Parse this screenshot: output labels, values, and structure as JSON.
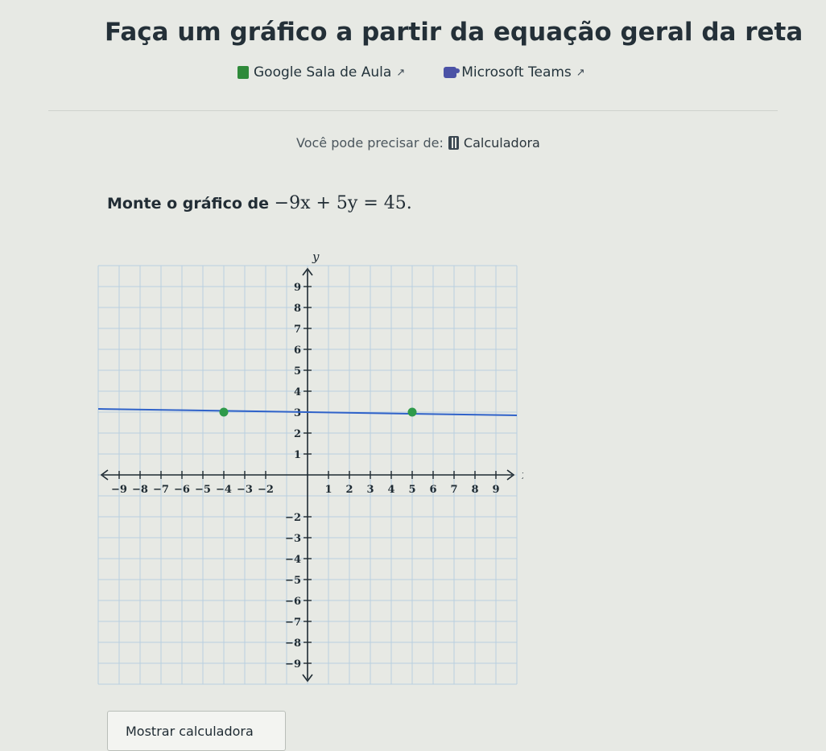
{
  "page": {
    "title": "Faça um gráfico a partir da equação geral da reta",
    "links": [
      {
        "label": "Google Sala de Aula",
        "icon": "google-classroom-icon"
      },
      {
        "label": "Microsoft Teams",
        "icon": "microsoft-teams-icon"
      }
    ],
    "resources": {
      "prefix": "Você pode precisar de:",
      "calculator_label": "Calculadora"
    },
    "question": {
      "prefix": "Monte o gráfico de",
      "equation": "−9x + 5y = 45."
    },
    "button_label": "Mostrar calculadora"
  },
  "chart_data": {
    "type": "line",
    "xlabel": "x",
    "ylabel": "y",
    "xlim": [
      -10,
      10
    ],
    "ylim": [
      -10,
      10
    ],
    "x_tick_labels": [
      "−9",
      "−8",
      "−7",
      "−6",
      "−5",
      "−4",
      "−3",
      "−2",
      "1",
      "2",
      "3",
      "4",
      "5",
      "6",
      "7",
      "8",
      "9"
    ],
    "y_tick_labels": [
      "9",
      "8",
      "7",
      "6",
      "5",
      "4",
      "3",
      "2",
      "1",
      "−2",
      "−3",
      "−4",
      "−5",
      "−6",
      "−7",
      "−8",
      "−9"
    ],
    "grid": true,
    "line_color": "#2f62c9",
    "point_color": "#2e9a4a",
    "points": [
      {
        "x": -4,
        "y": 3
      },
      {
        "x": 5,
        "y": 3
      }
    ],
    "series": [
      {
        "values": [
          [
            -10,
            3
          ],
          [
            10,
            3
          ]
        ]
      }
    ]
  }
}
